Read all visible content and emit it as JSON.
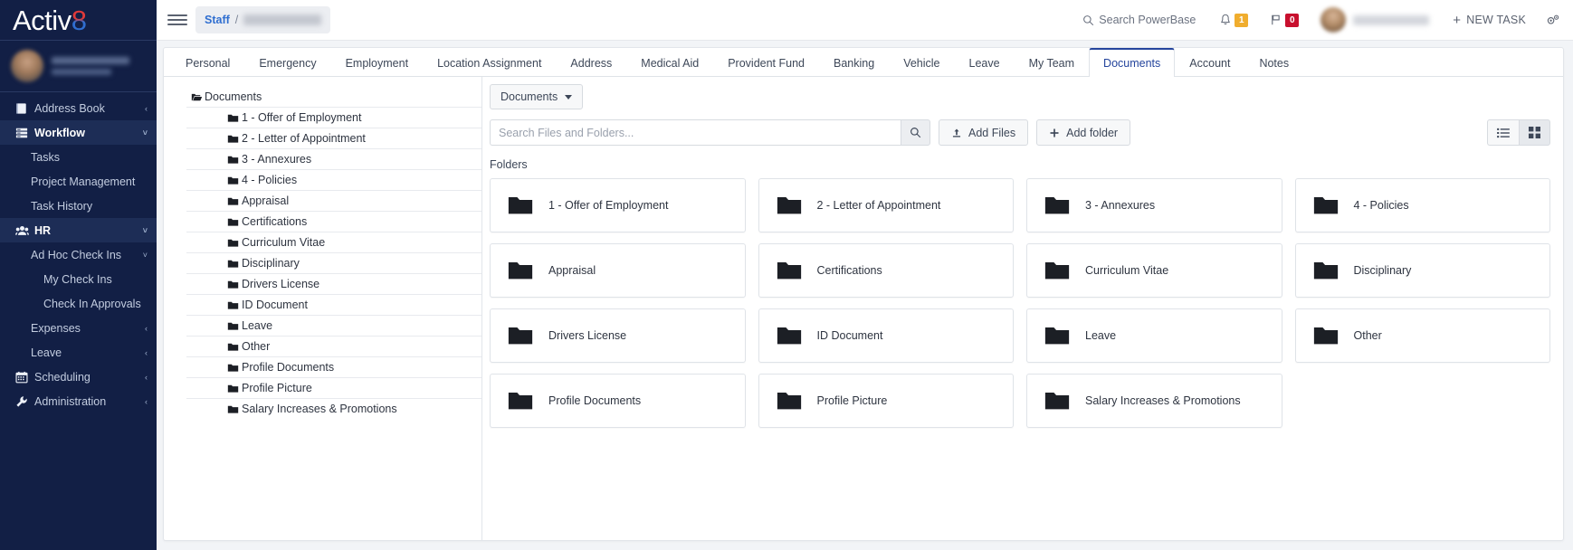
{
  "brand": {
    "name_main": "Activ",
    "name_accent": "8"
  },
  "sidebar": {
    "items": [
      {
        "label": "Address Book",
        "icon": "address-book-icon",
        "level": 1,
        "chevron": "‹",
        "active": false
      },
      {
        "label": "Workflow",
        "icon": "workflow-icon",
        "level": 1,
        "chevron": "˅",
        "active": true
      },
      {
        "label": "Tasks",
        "icon": "",
        "level": 2,
        "chevron": "",
        "active": false
      },
      {
        "label": "Project Management",
        "icon": "",
        "level": 2,
        "chevron": "",
        "active": false
      },
      {
        "label": "Task History",
        "icon": "",
        "level": 2,
        "chevron": "",
        "active": false
      },
      {
        "label": "HR",
        "icon": "people-icon",
        "level": 1,
        "chevron": "˅",
        "active": true
      },
      {
        "label": "Ad Hoc Check Ins",
        "icon": "",
        "level": 2,
        "chevron": "˅",
        "active": false
      },
      {
        "label": "My Check Ins",
        "icon": "",
        "level": 3,
        "chevron": "",
        "active": false
      },
      {
        "label": "Check In Approvals",
        "icon": "",
        "level": 3,
        "chevron": "",
        "active": false
      },
      {
        "label": "Expenses",
        "icon": "",
        "level": 2,
        "chevron": "‹",
        "active": false
      },
      {
        "label": "Leave",
        "icon": "",
        "level": 2,
        "chevron": "‹",
        "active": false
      },
      {
        "label": "Scheduling",
        "icon": "calendar-icon",
        "level": 1,
        "chevron": "‹",
        "active": false
      },
      {
        "label": "Administration",
        "icon": "wrench-icon",
        "level": 1,
        "chevron": "‹",
        "active": false
      }
    ]
  },
  "topbar": {
    "breadcrumb_root": "Staff",
    "breadcrumb_separator": "/",
    "search_label": "Search PowerBase",
    "notification_count": "1",
    "flag_count": "0",
    "new_task_label": "NEW TASK",
    "new_task_plus": "+"
  },
  "tabs": [
    {
      "label": "Personal",
      "active": false
    },
    {
      "label": "Emergency",
      "active": false
    },
    {
      "label": "Employment",
      "active": false
    },
    {
      "label": "Location Assignment",
      "active": false
    },
    {
      "label": "Address",
      "active": false
    },
    {
      "label": "Medical Aid",
      "active": false
    },
    {
      "label": "Provident Fund",
      "active": false
    },
    {
      "label": "Banking",
      "active": false
    },
    {
      "label": "Vehicle",
      "active": false
    },
    {
      "label": "Leave",
      "active": false
    },
    {
      "label": "My Team",
      "active": false
    },
    {
      "label": "Documents",
      "active": true
    },
    {
      "label": "Account",
      "active": false
    },
    {
      "label": "Notes",
      "active": false
    }
  ],
  "tree": {
    "root_label": "Documents",
    "items": [
      "1 - Offer of Employment",
      "2 - Letter of Appointment",
      "3 - Annexures",
      "4 - Policies",
      "Appraisal",
      "Certifications",
      "Curriculum Vitae",
      "Disciplinary",
      "Drivers License",
      "ID Document",
      "Leave",
      "Other",
      "Profile Documents",
      "Profile Picture",
      "Salary Increases & Promotions"
    ]
  },
  "files_panel": {
    "dropdown_label": "Documents",
    "search_placeholder": "Search Files and Folders...",
    "search_value": "",
    "add_files_label": "Add Files",
    "add_folder_label": "Add folder",
    "section_label": "Folders",
    "folders": [
      "1 - Offer of Employment",
      "2 - Letter of Appointment",
      "3 - Annexures",
      "4 - Policies",
      "Appraisal",
      "Certifications",
      "Curriculum Vitae",
      "Disciplinary",
      "Drivers License",
      "ID Document",
      "Leave",
      "Other",
      "Profile Documents",
      "Profile Picture",
      "Salary Increases & Promotions"
    ]
  },
  "colors": {
    "sidebar_bg": "#121f45",
    "accent_blue": "#2f6ed0",
    "active_tab": "#24449c",
    "badge_warn": "#f0ad2e",
    "badge_danger": "#c8102e"
  }
}
